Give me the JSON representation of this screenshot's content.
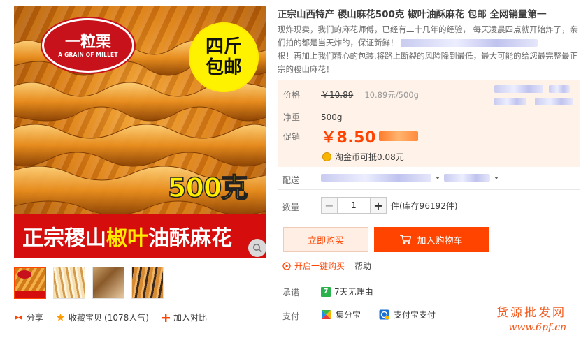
{
  "product_image": {
    "logo_text": "一粒栗",
    "logo_subtext": "A GRAIN OF MILLET",
    "badge_line1": "四斤",
    "badge_line2": "包邮",
    "weight_label": "500克",
    "banner_part1": "正宗稷山",
    "banner_part2": "椒叶",
    "banner_part3": "油酥麻花"
  },
  "share_row": {
    "share_label": "分享",
    "favorite_label": "收藏宝贝",
    "favorite_count": "(1078人气)",
    "compare_label": "加入对比"
  },
  "product": {
    "title": "正宗山西特产 稷山麻花500克 椒叶油酥麻花 包邮 全网销量第一",
    "description_part1": "现炸现卖，我们的麻花师傅，已经有二十几年的经验， 每天凌晨四点就开始炸了，亲们拍的都是当天炸的，保证新鲜！",
    "description_part2": "根！再加上我们精心的包装,将路上断裂的风险降到最低，最大可能的给您最完整最正宗的稷山麻花！"
  },
  "price": {
    "price_label": "价格",
    "original_price": "￥10.89",
    "unit_price": "10.89元/500g",
    "net_label": "净重",
    "net_value": "500g",
    "promo_label": "促销",
    "promo_price": "￥8.50",
    "coin_text": "淘金币可抵",
    "coin_value": "0.08元"
  },
  "delivery": {
    "label": "配送"
  },
  "quantity": {
    "label": "数量",
    "value": "1",
    "minus": "−",
    "plus": "+",
    "stock_text": "件(库存96192件)"
  },
  "actions": {
    "buy_now": "立即购买",
    "add_to_cart": "加入购物车",
    "one_click": "开启一键购买",
    "help": "帮助"
  },
  "service": {
    "promise_label": "承诺",
    "promise_badge": "7",
    "promise_text": "7天无理由",
    "pay_label": "支付",
    "pay_method1": "集分宝",
    "pay_method2": "支付宝支付"
  },
  "watermark": {
    "cn": "货源批发网",
    "url": "www.6pf.cn"
  },
  "colors": {
    "accent": "#ff4400",
    "price_bg": "#fff2e8",
    "buy_now_bg": "#ffeee4",
    "banner_red": "#d60d0d",
    "badge_yellow": "#fff200"
  }
}
